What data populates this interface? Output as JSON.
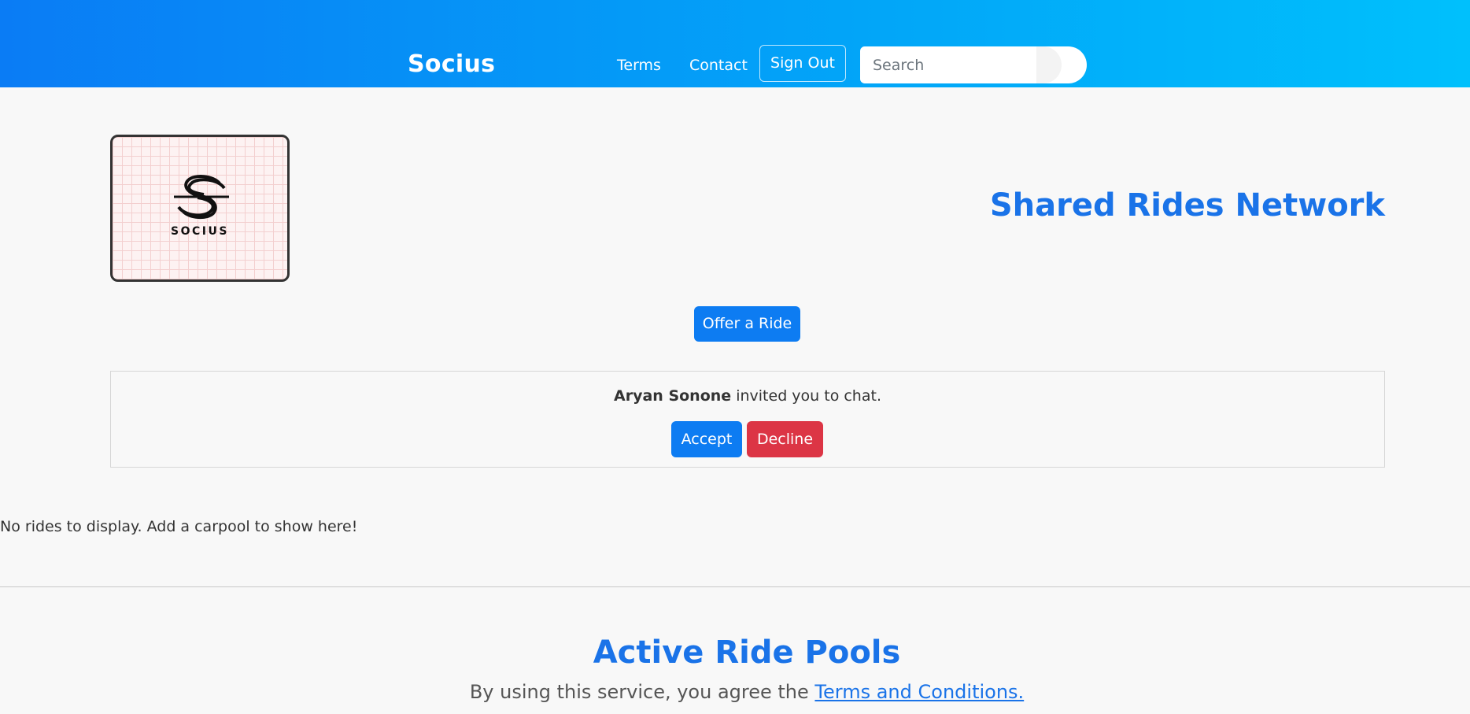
{
  "navbar": {
    "brand": "Socius",
    "links": [
      {
        "label": "Terms"
      },
      {
        "label": "Contact"
      }
    ],
    "signout_label": "Sign Out",
    "search": {
      "placeholder": "Search",
      "value": ""
    },
    "gradient_start": "#0a7cf5",
    "gradient_end": "#00c0fc"
  },
  "hero": {
    "logo_text": "SOCIUS",
    "title": "Shared Rides Network",
    "offer_button": "Offer a Ride"
  },
  "invite": {
    "sender": "Aryan Sonone",
    "message": " invited you to chat.",
    "accept_label": "Accept",
    "decline_label": "Decline"
  },
  "rides": {
    "empty_message": "No rides to display. Add a carpool to show here!"
  },
  "pools": {
    "title": "Active Ride Pools",
    "terms_prefix": "By using this service, you agree the ",
    "terms_link": "Terms and Conditions."
  },
  "colors": {
    "primary": "#0d7cf2",
    "danger": "#dc3545",
    "heading": "#1a73e8"
  }
}
